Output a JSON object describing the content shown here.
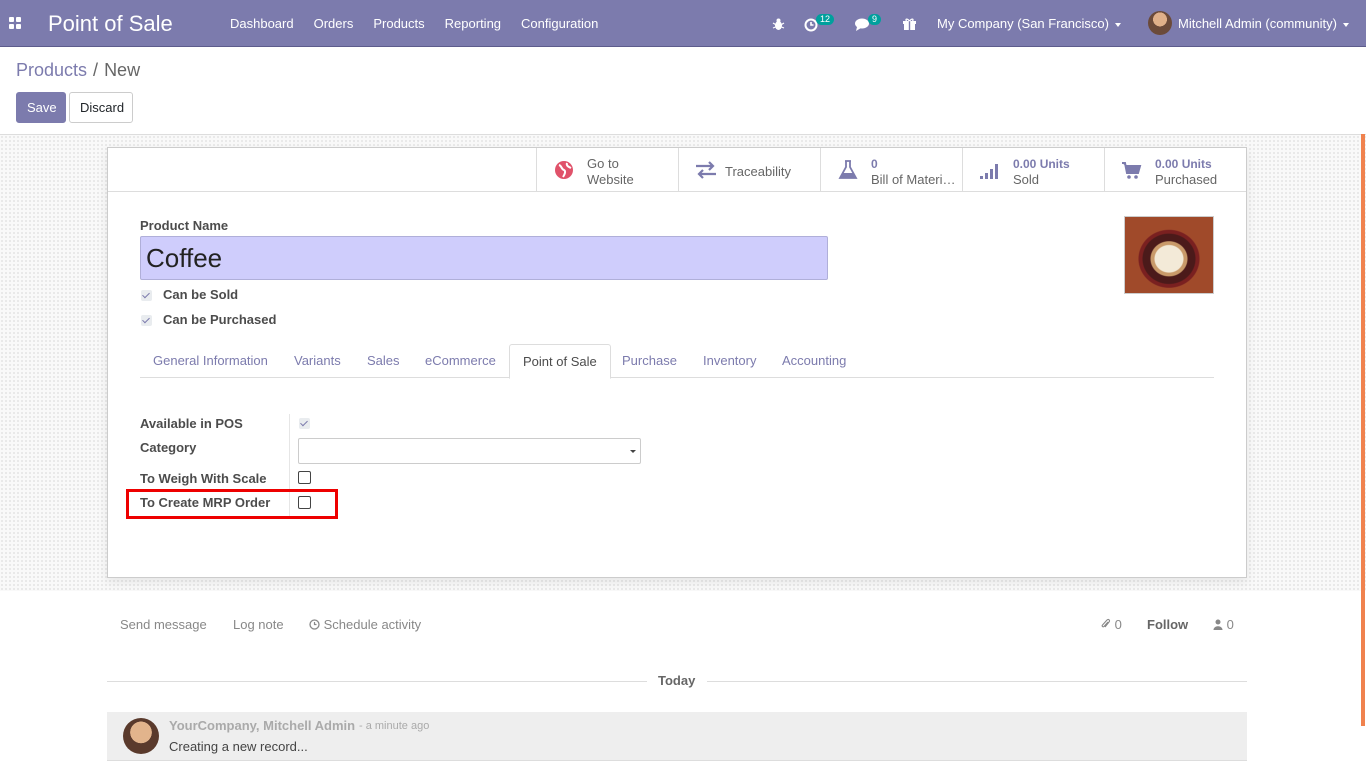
{
  "navbar": {
    "app_title": "Point of Sale",
    "menu": [
      "Dashboard",
      "Orders",
      "Products",
      "Reporting",
      "Configuration"
    ],
    "activity_count": "12",
    "message_count": "9",
    "company": "My Company (San Francisco)",
    "user": "Mitchell Admin (community)"
  },
  "breadcrumb": {
    "parent": "Products",
    "separator": "/",
    "current": "New"
  },
  "buttons": {
    "save": "Save",
    "discard": "Discard"
  },
  "smart_buttons": {
    "website": {
      "line1": "Go to",
      "line2": "Website"
    },
    "traceability": {
      "label": "Traceability"
    },
    "bom": {
      "value": "0",
      "label": "Bill of Materials"
    },
    "sold": {
      "value": "0.00 Units",
      "label": "Sold"
    },
    "purchased": {
      "value": "0.00 Units",
      "label": "Purchased"
    }
  },
  "product": {
    "name_label": "Product Name",
    "name": "Coffee",
    "can_be_sold_label": "Can be Sold",
    "can_be_purchased_label": "Can be Purchased"
  },
  "tabs": [
    "General Information",
    "Variants",
    "Sales",
    "eCommerce",
    "Point of Sale",
    "Purchase",
    "Inventory",
    "Accounting"
  ],
  "pos_tab": {
    "available_label": "Available in POS",
    "category_label": "Category",
    "category_value": "",
    "weigh_label": "To Weigh With Scale",
    "mrp_label": "To Create MRP Order"
  },
  "chatter": {
    "send_message": "Send message",
    "log_note": "Log note",
    "schedule_activity": "Schedule activity",
    "attachments": "0",
    "follow": "Follow",
    "followers": "0",
    "date_separator": "Today",
    "message": {
      "author": "YourCompany, Mitchell Admin",
      "time": "- a minute ago",
      "body": "Creating a new record..."
    }
  },
  "colors": {
    "brand": "#7c7bad",
    "badge": "#00a09d",
    "highlight": "#e00000",
    "name_field_bg": "#cfcdfc"
  }
}
